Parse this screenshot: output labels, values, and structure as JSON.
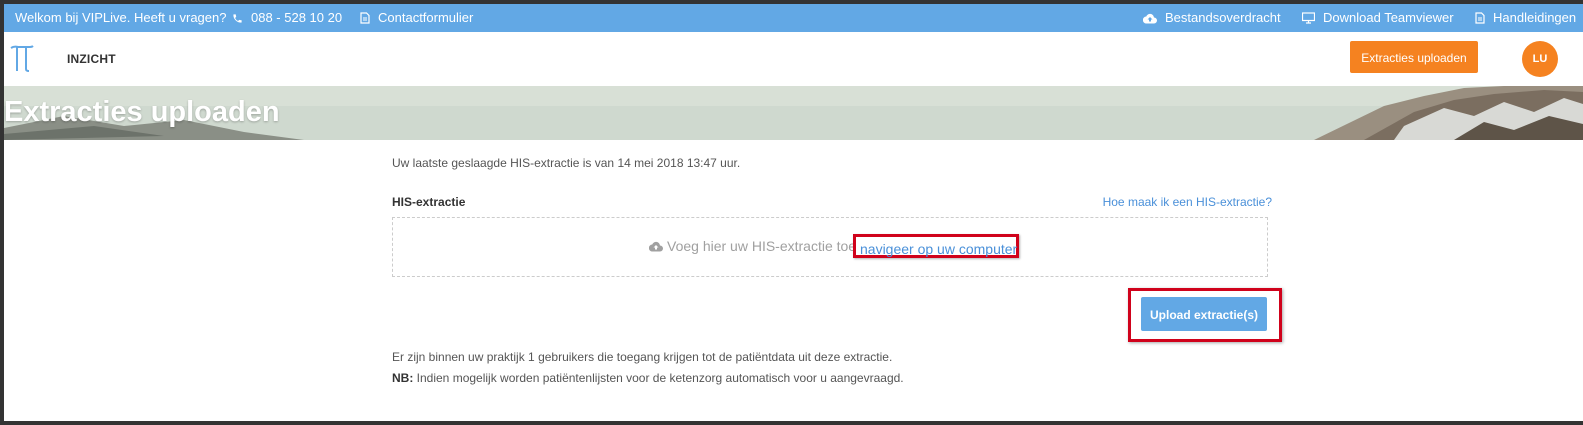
{
  "topbar": {
    "welcome": "Welkom bij VIPLive. Heeft u vragen?",
    "phone": "088 - 528 10 20",
    "contact": "Contactformulier",
    "transfer": "Bestandsoverdracht",
    "teamviewer": "Download Teamviewer",
    "manuals": "Handleidingen"
  },
  "nav": {
    "logo_icon": "pi-icon",
    "insight": "INZICHT",
    "upload_button": "Extracties uploaden",
    "avatar_initials": "LU"
  },
  "hero": {
    "title": "Extracties uploaden"
  },
  "content": {
    "last_success": "Uw laatste geslaagde HIS-extractie is van 14 mei 2018 13:47 uur.",
    "section_label": "HIS-extractie",
    "help_link": "Hoe maak ik een HIS-extractie?",
    "drop_text": "Voeg hier uw HIS-extractie toe",
    "drop_link": "navigeer op uw computer",
    "upload_button": "Upload extractie(s)",
    "info_users": "Er zijn binnen uw praktijk 1 gebruikers die toegang krijgen tot de patiëntdata uit deze extractie.",
    "nb_label": "NB:",
    "nb_text": " Indien mogelijk worden patiëntenlijsten voor de ketenzorg automatisch voor u aangevraagd."
  },
  "colors": {
    "topbar": "#62a8e5",
    "accent_orange": "#f58220",
    "link_blue": "#4a90d9",
    "highlight_red": "#d0021b"
  }
}
